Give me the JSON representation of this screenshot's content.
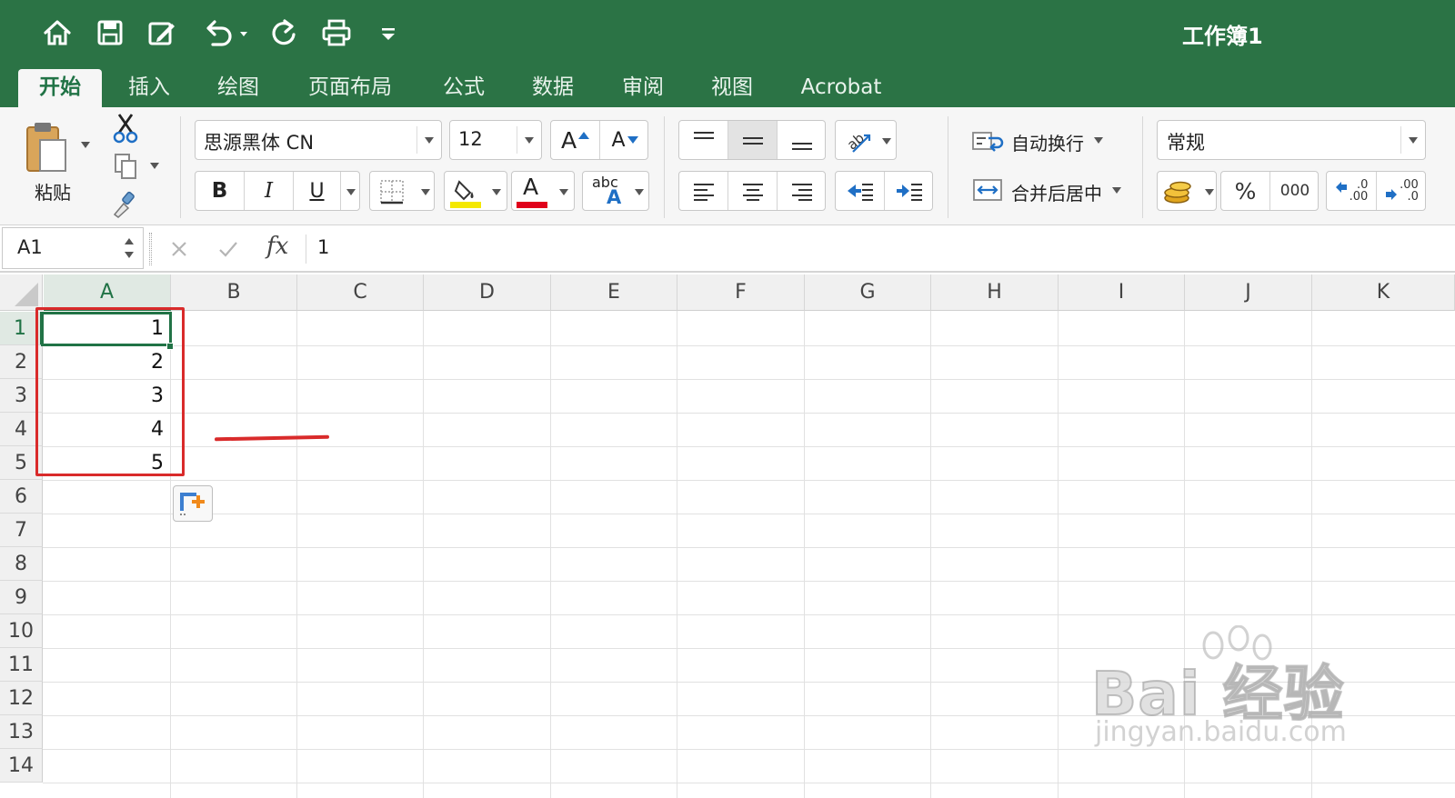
{
  "window": {
    "title": "工作簿1"
  },
  "tabs": [
    {
      "label": "开始",
      "active": true
    },
    {
      "label": "插入"
    },
    {
      "label": "绘图"
    },
    {
      "label": "页面布局"
    },
    {
      "label": "公式"
    },
    {
      "label": "数据"
    },
    {
      "label": "审阅"
    },
    {
      "label": "视图"
    },
    {
      "label": "Acrobat"
    }
  ],
  "ribbon": {
    "paste_label": "粘贴",
    "font_name": "思源黑体 CN",
    "font_size": "12",
    "grow_font": "A",
    "shrink_font": "A",
    "bold": "B",
    "italic": "I",
    "underline": "U",
    "font_color_letter": "A",
    "phonetic_top": "abc",
    "phonetic_bottom": "A",
    "wrap_text": "自动换行",
    "merge_center": "合并后居中",
    "number_format": "常规",
    "percent": "%",
    "thousands": "000",
    "increase_decimal": ".0\n.00",
    "decrease_decimal": ".00\n.0",
    "fill_color": "#f4e800",
    "font_color": "#e0001b"
  },
  "formula_bar": {
    "name_box": "A1",
    "fx": "fx",
    "value": "1"
  },
  "sheet": {
    "columns": [
      "A",
      "B",
      "C",
      "D",
      "E",
      "F",
      "G",
      "H",
      "I",
      "J",
      "K"
    ],
    "rows": [
      "1",
      "2",
      "3",
      "4",
      "5",
      "6",
      "7",
      "8",
      "9",
      "10",
      "11",
      "12",
      "13",
      "14"
    ],
    "cells": {
      "A1": "1",
      "A2": "2",
      "A3": "3",
      "A4": "4",
      "A5": "5"
    },
    "selected_cell": "A1"
  },
  "watermark": {
    "line1": "Bai 经验",
    "line2": "jingyan.baidu.com"
  },
  "colors": {
    "accent": "#217346",
    "titlebar": "#2b7345",
    "annotation": "#d92b2b"
  }
}
